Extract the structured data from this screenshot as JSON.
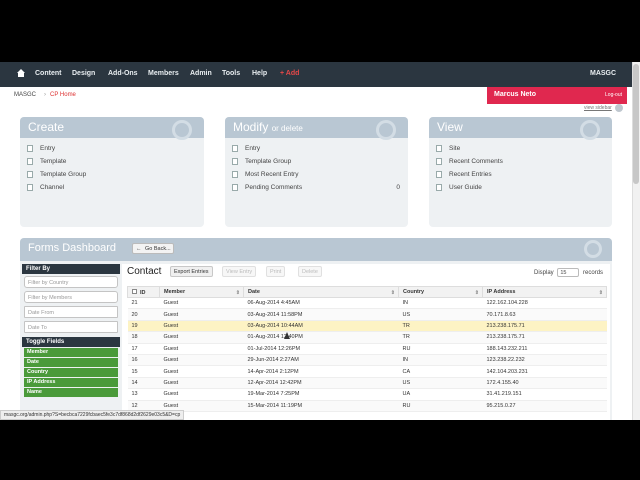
{
  "nav": {
    "items": [
      "Content",
      "Design",
      "Add-Ons",
      "Members",
      "Admin",
      "Tools",
      "Help"
    ],
    "add": "+ Add",
    "site": "MASGC"
  },
  "breadcrumb": {
    "site": "MASGC",
    "sep": "›",
    "current": "CP Home"
  },
  "user": {
    "name": "Marcus Neto",
    "logout": "Log-out",
    "view_sidebar": "view sidebar"
  },
  "create": {
    "title": "Create",
    "items": [
      "Entry",
      "Template",
      "Template Group",
      "Channel"
    ]
  },
  "modify": {
    "title": "Modify",
    "subtitle": "or delete",
    "items": [
      "Entry",
      "Template Group",
      "Most Recent Entry",
      "Pending Comments"
    ],
    "pending_count": "0"
  },
  "view": {
    "title": "View",
    "items": [
      "Site",
      "Recent Comments",
      "Recent Entries",
      "User Guide"
    ]
  },
  "dashboard": {
    "title": "Forms Dashboard",
    "go_back": "Go Back..."
  },
  "filter": {
    "title": "Filter By",
    "country_placeholder": "Filter by Country",
    "members_placeholder": "Filter by Members",
    "date_from": "Date From",
    "date_to": "Date To",
    "toggle_title": "Toggle Fields",
    "toggles": [
      "Member",
      "Date",
      "Country",
      "IP Address",
      "Name"
    ]
  },
  "contact": {
    "title": "Contact",
    "export": "Export Entries",
    "view_entry": "View Entry",
    "print": "Print",
    "delete": "Delete",
    "display_label": "Display",
    "display_value": "15",
    "records_label": "records",
    "columns": [
      "ID",
      "Member",
      "Date",
      "Country",
      "IP Address"
    ],
    "rows": [
      [
        "21",
        "Guest",
        "06-Aug-2014 4:45AM",
        "IN",
        "122.162.104.228"
      ],
      [
        "20",
        "Guest",
        "03-Aug-2014 11:58PM",
        "US",
        "70.171.8.63"
      ],
      [
        "19",
        "Guest",
        "03-Aug-2014 10:44AM",
        "TR",
        "213.238.175.71"
      ],
      [
        "18",
        "Guest",
        "01-Aug-2014 12:40PM",
        "TR",
        "213.238.175.71"
      ],
      [
        "17",
        "Guest",
        "01-Jul-2014 12:26PM",
        "RU",
        "188.143.232.211"
      ],
      [
        "16",
        "Guest",
        "29-Jun-2014 2:27AM",
        "IN",
        "123.238.22.232"
      ],
      [
        "15",
        "Guest",
        "14-Apr-2014 2:12PM",
        "CA",
        "142.104.203.231"
      ],
      [
        "14",
        "Guest",
        "12-Apr-2014 12:42PM",
        "US",
        "172.4.155.40"
      ],
      [
        "13",
        "Guest",
        "19-Mar-2014 7:25PM",
        "UA",
        "31.41.219.151"
      ],
      [
        "12",
        "Guest",
        "15-Mar-2014 11:19PM",
        "RU",
        "95.215.0.27"
      ]
    ]
  },
  "status_url": "masgc.org/admin.php?S=becbca7229fcbaec5fe3c7df868d2df2629e03c5&D=cp"
}
